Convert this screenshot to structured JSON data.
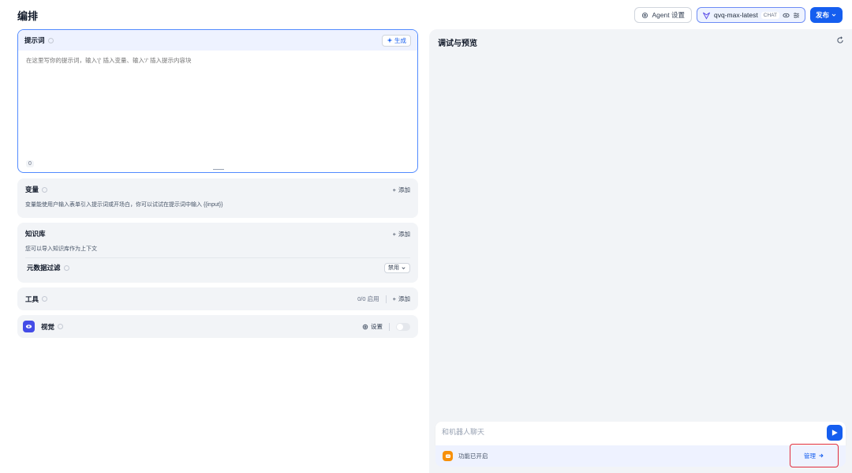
{
  "header": {
    "title": "编排",
    "agent_settings_label": "Agent 设置",
    "model_name": "qvq-max-latest",
    "model_badge": "CHAT",
    "publish_label": "发布"
  },
  "prompt": {
    "title": "提示词",
    "generate_label": "生成",
    "placeholder": "在这里写你的提示词，输入'{' 插入变量、输入'/' 插入提示内容块",
    "char_count": "0"
  },
  "variables": {
    "title": "变量",
    "add_label": "添加",
    "description": "变量能使用户输入表单引入提示词或开场白，你可以试试在提示词中输入 {{input}}"
  },
  "knowledge": {
    "title": "知识库",
    "add_label": "添加",
    "description": "您可以导入知识库作为上下文",
    "metadata_filter_label": "元数据过滤",
    "metadata_filter_value": "禁用"
  },
  "tools": {
    "title": "工具",
    "count": "0/0 启用",
    "add_label": "添加"
  },
  "vision": {
    "title": "视觉",
    "settings_label": "设置",
    "enabled": false
  },
  "preview": {
    "title": "调试与预览",
    "chat_placeholder": "和机器人聊天",
    "feature_status": "功能已开启",
    "manage_label": "管理"
  },
  "colors": {
    "primary": "#155eef",
    "highlight_border": "#e02d3c",
    "panel_bg": "#f2f4f7"
  }
}
